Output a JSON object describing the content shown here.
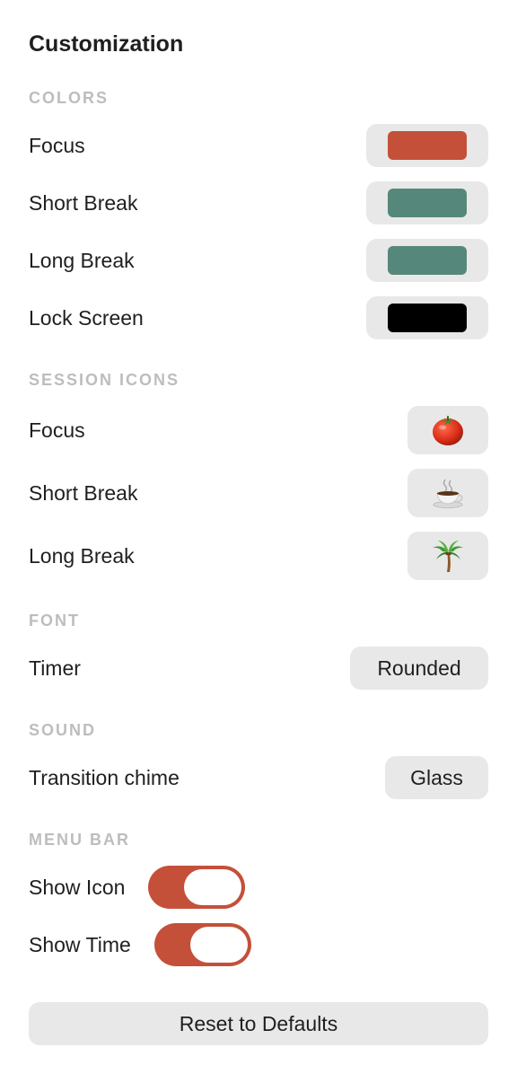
{
  "title": "Customization",
  "colors": {
    "header": "COLORS",
    "items": [
      {
        "label": "Focus",
        "color": "#c45039"
      },
      {
        "label": "Short Break",
        "color": "#55887a"
      },
      {
        "label": "Long Break",
        "color": "#55887a"
      },
      {
        "label": "Lock Screen",
        "color": "#000000"
      }
    ]
  },
  "session_icons": {
    "header": "SESSION ICONS",
    "items": [
      {
        "label": "Focus",
        "icon": "tomato-icon"
      },
      {
        "label": "Short Break",
        "icon": "coffee-icon"
      },
      {
        "label": "Long Break",
        "icon": "palm-tree-icon"
      }
    ]
  },
  "font": {
    "header": "FONT",
    "label": "Timer",
    "value": "Rounded"
  },
  "sound": {
    "header": "SOUND",
    "label": "Transition chime",
    "value": "Glass"
  },
  "menu_bar": {
    "header": "MENU BAR",
    "show_icon_label": "Show Icon",
    "show_icon_on": true,
    "show_time_label": "Show Time",
    "show_time_on": true,
    "accent": "#c45039"
  },
  "reset_label": "Reset to Defaults"
}
